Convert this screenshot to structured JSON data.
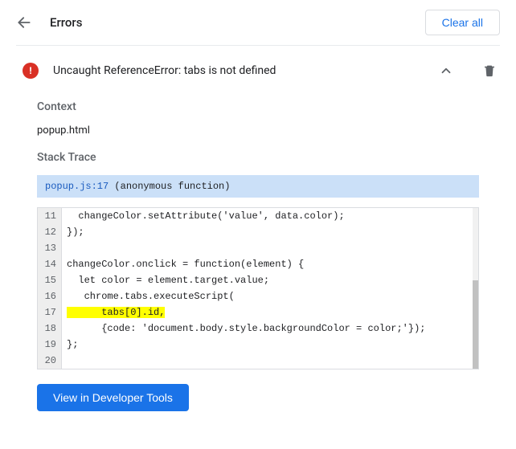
{
  "header": {
    "title": "Errors",
    "clear_all_label": "Clear all"
  },
  "error": {
    "message": "Uncaught ReferenceError: tabs is not defined",
    "badge_glyph": "!"
  },
  "context": {
    "label": "Context",
    "value": "popup.html"
  },
  "stack_trace": {
    "label": "Stack Trace",
    "frame_location": "popup.js:17",
    "frame_function": " (anonymous function)"
  },
  "code": {
    "lines": [
      {
        "num": "11",
        "text": "  changeColor.setAttribute('value', data.color);",
        "hl": false
      },
      {
        "num": "12",
        "text": "});",
        "hl": false
      },
      {
        "num": "13",
        "text": "",
        "hl": false
      },
      {
        "num": "14",
        "text": "changeColor.onclick = function(element) {",
        "hl": false
      },
      {
        "num": "15",
        "text": "  let color = element.target.value;",
        "hl": false
      },
      {
        "num": "16",
        "text": "   chrome.tabs.executeScript(",
        "hl": false
      },
      {
        "num": "17",
        "text": "      tabs[0].id,",
        "hl": true
      },
      {
        "num": "18",
        "text": "      {code: 'document.body.style.backgroundColor = color;'});",
        "hl": false
      },
      {
        "num": "19",
        "text": "};",
        "hl": false
      },
      {
        "num": "20",
        "text": "",
        "hl": false
      }
    ]
  },
  "footer": {
    "dev_tools_label": "View in Developer Tools"
  }
}
